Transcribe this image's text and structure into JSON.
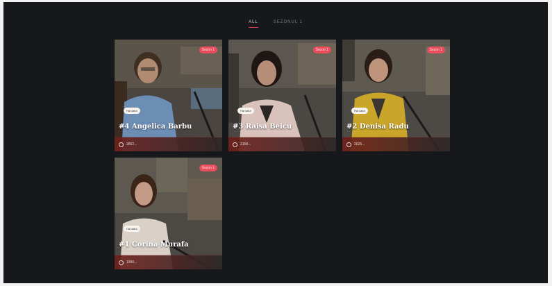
{
  "filters": {
    "items": [
      "ALL",
      "SEZONUL 1"
    ],
    "active": 0
  },
  "accent": "#e04455",
  "episodes": [
    {
      "title": "#4 Angelica Barbu",
      "season": "Sezon 1",
      "bubble": "Hai salut",
      "views": "2802..."
    },
    {
      "title": "#3 Raisa Beicu",
      "season": "Sezon 1",
      "bubble": "Hai salut",
      "views": "2158..."
    },
    {
      "title": "#2 Denisa Radu",
      "season": "Sezon 1",
      "bubble": "Hai salut",
      "views": "2626..."
    },
    {
      "title": "#1 Corina Murafa",
      "season": "Sezon 1",
      "bubble": "Hai salut",
      "views": "1990..."
    }
  ]
}
